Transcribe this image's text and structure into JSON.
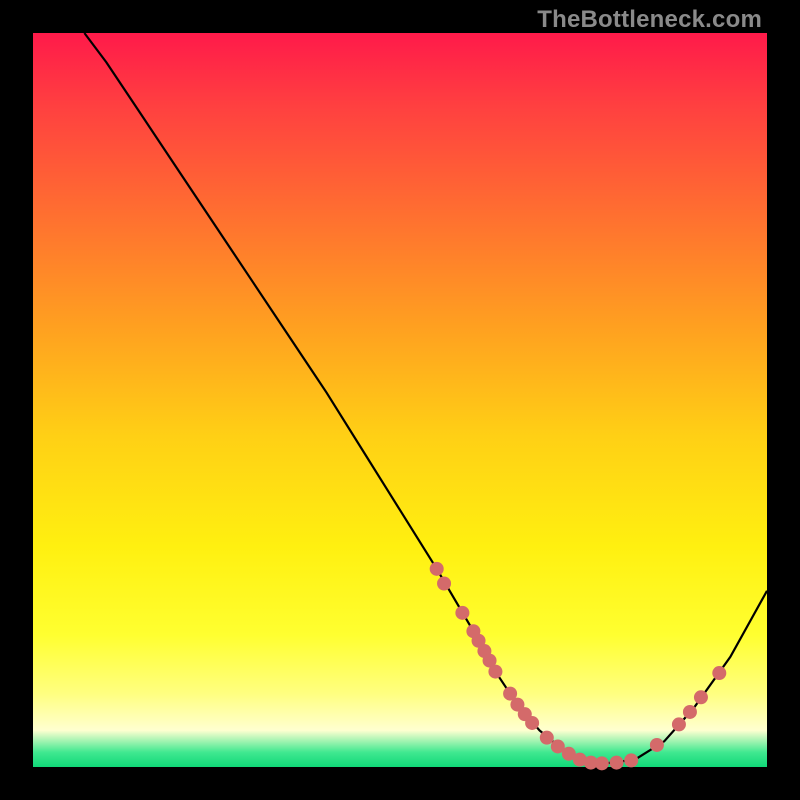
{
  "watermark": "TheBottleneck.com",
  "chart_data": {
    "type": "line",
    "title": "",
    "xlabel": "",
    "ylabel": "",
    "xlim": [
      0,
      100
    ],
    "ylim": [
      0,
      100
    ],
    "series": [
      {
        "name": "curve",
        "x": [
          7,
          10,
          15,
          20,
          25,
          30,
          35,
          40,
          45,
          50,
          55,
          60,
          63,
          66,
          69,
          72,
          75,
          78,
          82,
          86,
          90,
          95,
          100
        ],
        "y": [
          100,
          96,
          88.5,
          81,
          73.5,
          66,
          58.5,
          51,
          43,
          35,
          27,
          18.5,
          13,
          8.5,
          5,
          2.5,
          1,
          0.5,
          1,
          3.5,
          8,
          15,
          24
        ]
      }
    ],
    "markers": [
      {
        "x": 55.0,
        "y": 27.0
      },
      {
        "x": 56.0,
        "y": 25.0
      },
      {
        "x": 58.5,
        "y": 21.0
      },
      {
        "x": 60.0,
        "y": 18.5
      },
      {
        "x": 60.7,
        "y": 17.2
      },
      {
        "x": 61.5,
        "y": 15.8
      },
      {
        "x": 62.2,
        "y": 14.5
      },
      {
        "x": 63.0,
        "y": 13.0
      },
      {
        "x": 65.0,
        "y": 10.0
      },
      {
        "x": 66.0,
        "y": 8.5
      },
      {
        "x": 67.0,
        "y": 7.2
      },
      {
        "x": 68.0,
        "y": 6.0
      },
      {
        "x": 70.0,
        "y": 4.0
      },
      {
        "x": 71.5,
        "y": 2.8
      },
      {
        "x": 73.0,
        "y": 1.8
      },
      {
        "x": 74.5,
        "y": 1.0
      },
      {
        "x": 76.0,
        "y": 0.6
      },
      {
        "x": 77.5,
        "y": 0.5
      },
      {
        "x": 79.5,
        "y": 0.6
      },
      {
        "x": 81.5,
        "y": 0.9
      },
      {
        "x": 85.0,
        "y": 3.0
      },
      {
        "x": 88.0,
        "y": 5.8
      },
      {
        "x": 89.5,
        "y": 7.5
      },
      {
        "x": 91.0,
        "y": 9.5
      },
      {
        "x": 93.5,
        "y": 12.8
      }
    ],
    "marker_style": {
      "color": "#d46a6a",
      "radius": 7
    },
    "curve_style": {
      "color": "#000000",
      "width": 2.2
    }
  }
}
